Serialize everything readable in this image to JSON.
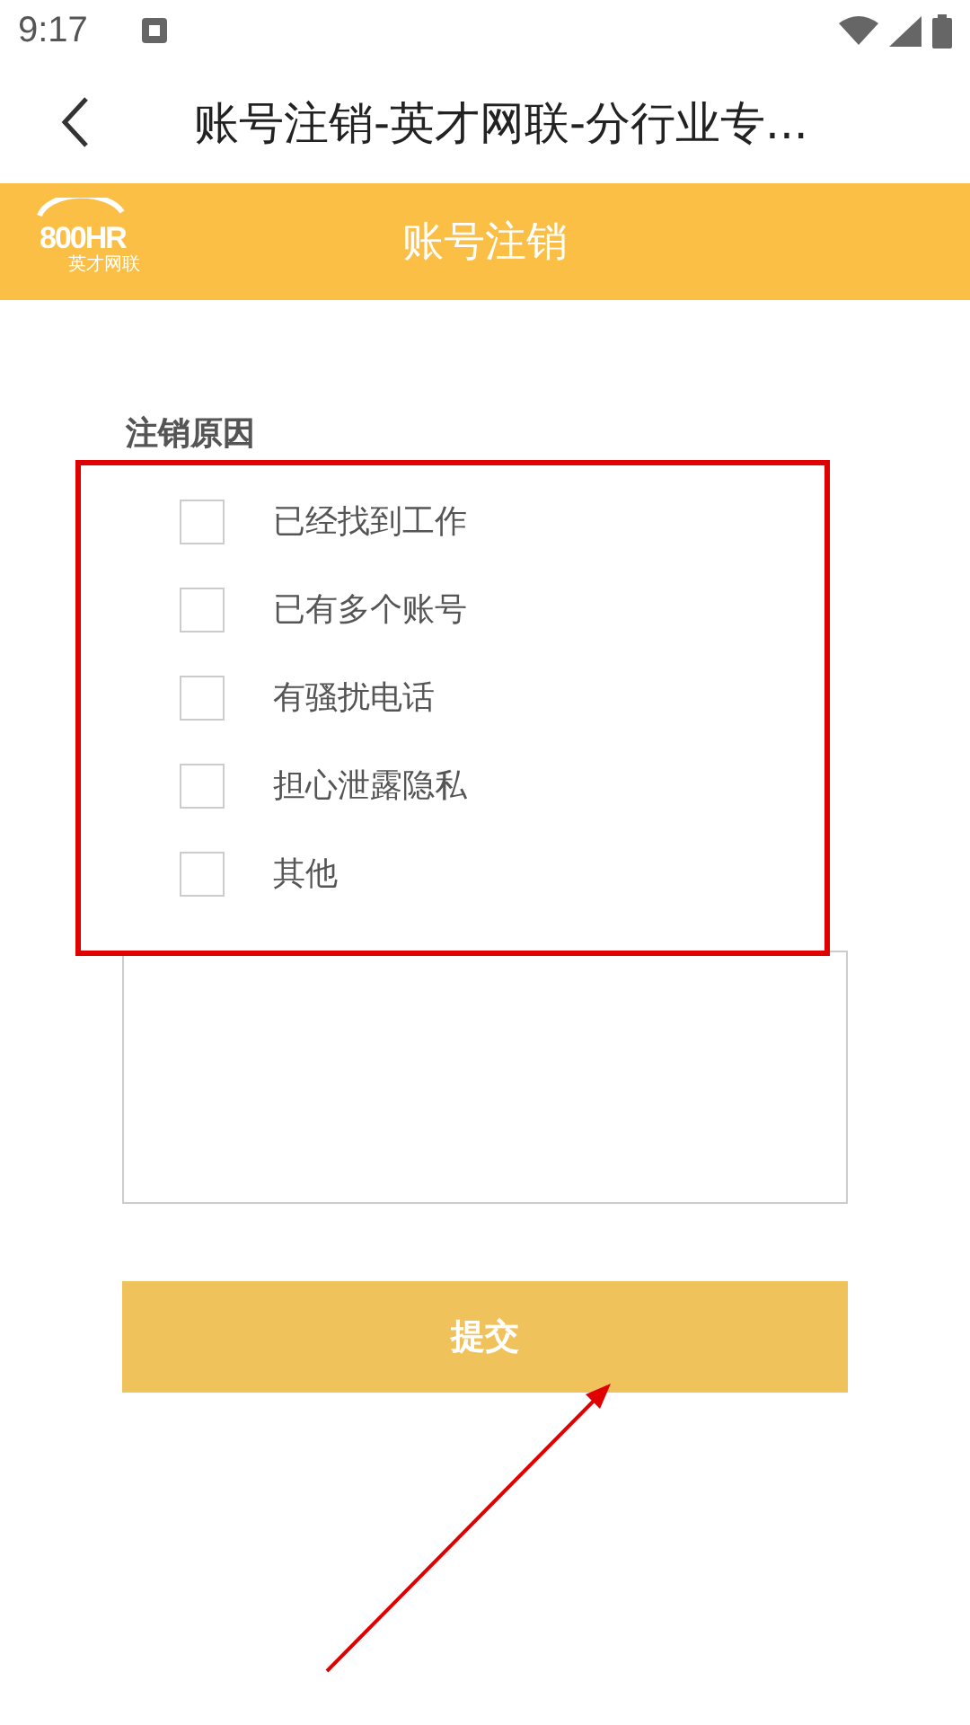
{
  "status_bar": {
    "time": "9:17"
  },
  "title_bar": {
    "title": "账号注销-英才网联-分行业专..."
  },
  "banner": {
    "logo_number": "800HR",
    "logo_name": "英才网联",
    "title": "账号注销"
  },
  "form": {
    "heading": "注销原因",
    "reasons": [
      {
        "label": "已经找到工作",
        "checked": false
      },
      {
        "label": "已有多个账号",
        "checked": false
      },
      {
        "label": "有骚扰电话",
        "checked": false
      },
      {
        "label": "担心泄露隐私",
        "checked": false
      },
      {
        "label": "其他",
        "checked": false
      }
    ],
    "submit": "提交"
  }
}
